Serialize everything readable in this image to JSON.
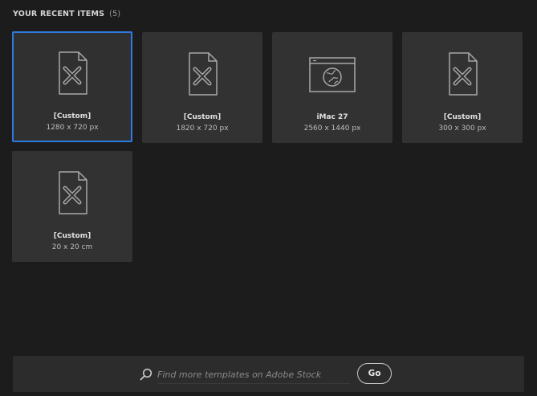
{
  "header": {
    "title": "YOUR RECENT ITEMS",
    "count": "(5)"
  },
  "recent_items": [
    {
      "name": "[Custom]",
      "size": "1280 x 720 px",
      "icon": "document-edit-icon",
      "selected": true
    },
    {
      "name": "[Custom]",
      "size": "1820 x 720 px",
      "icon": "document-edit-icon",
      "selected": false
    },
    {
      "name": "iMac 27",
      "size": "2560 x 1440 px",
      "icon": "web-globe-icon",
      "selected": false
    },
    {
      "name": "[Custom]",
      "size": "300 x 300 px",
      "icon": "document-edit-icon",
      "selected": false
    },
    {
      "name": "[Custom]",
      "size": "20 x 20 cm",
      "icon": "document-edit-icon",
      "selected": false
    }
  ],
  "search": {
    "placeholder": "Find more templates on Adobe Stock",
    "value": "",
    "go_label": "Go",
    "icon": "search-icon"
  },
  "colors": {
    "background": "#1c1c1c",
    "card": "#323232",
    "selected_border": "#2d7ae0"
  }
}
